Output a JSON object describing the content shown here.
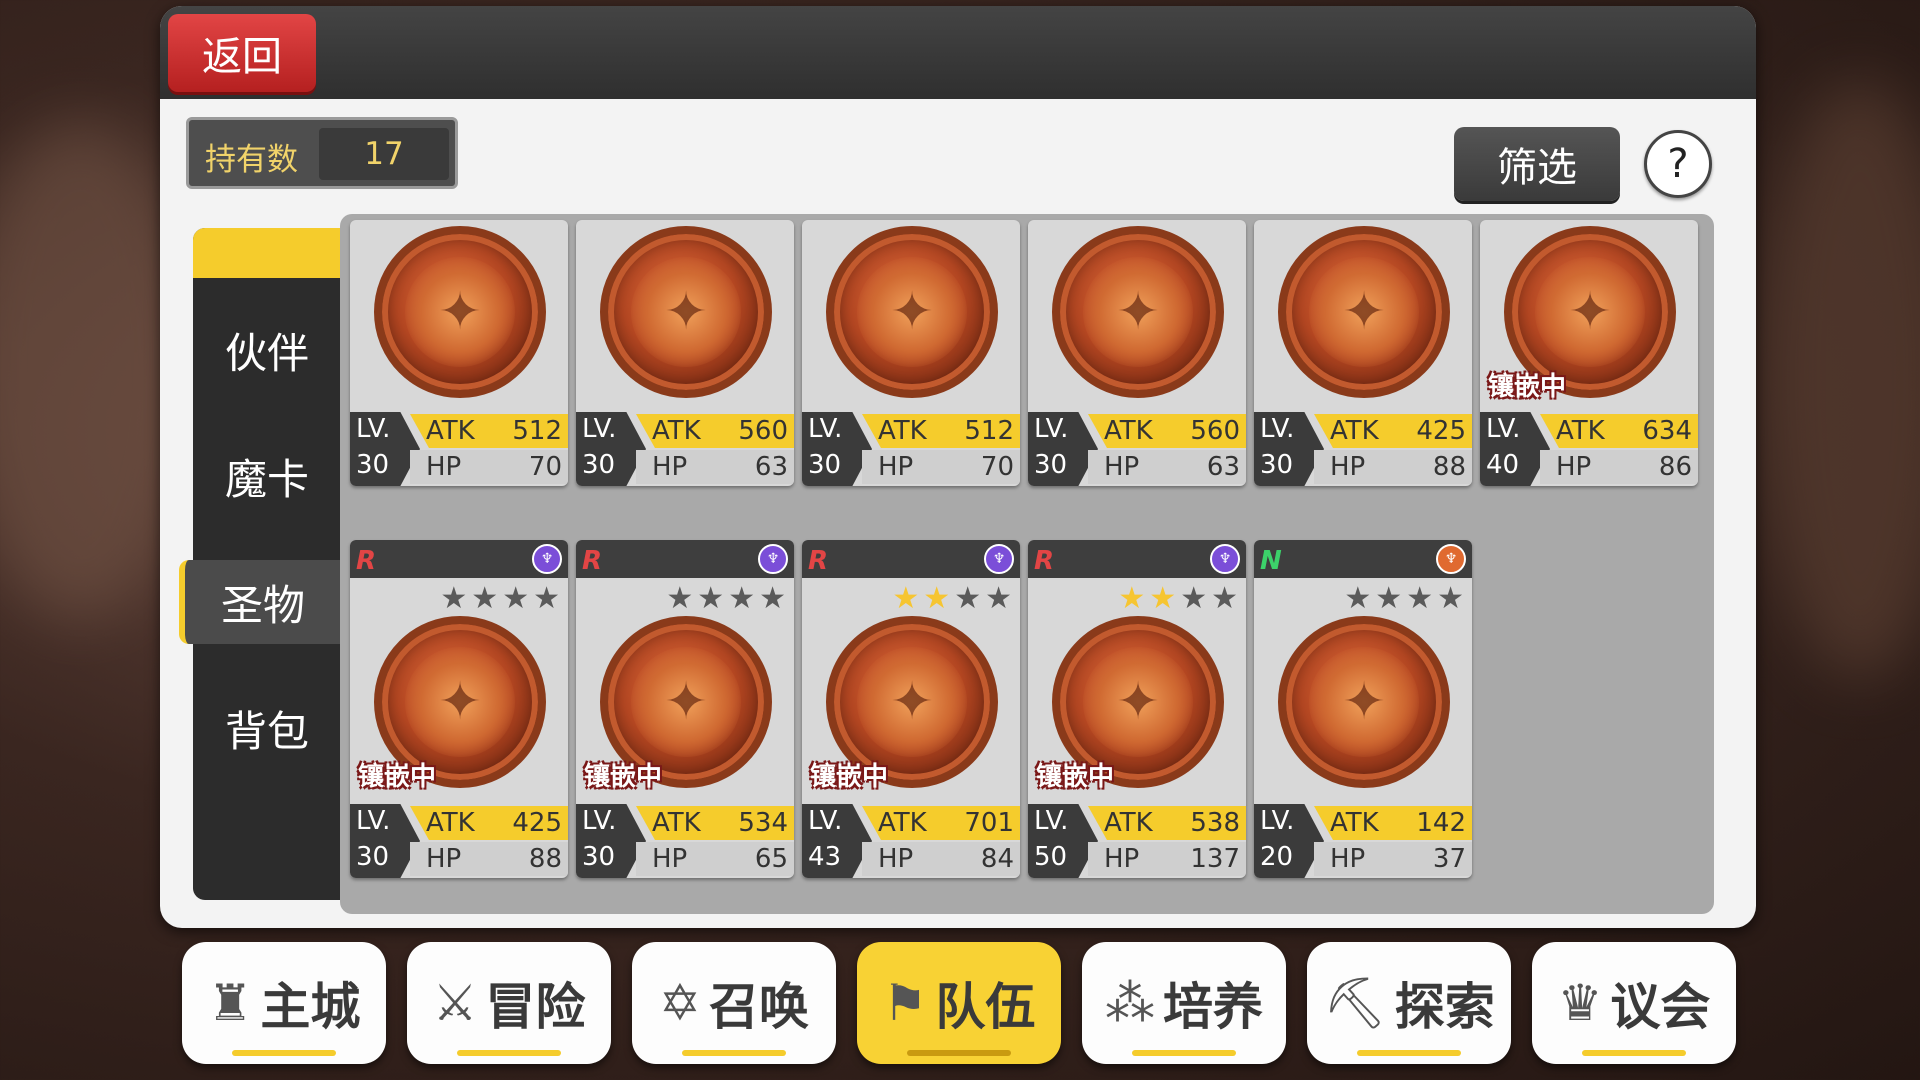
{
  "header": {
    "back_label": "返回"
  },
  "holdings": {
    "label": "持有数",
    "value": "17"
  },
  "toolbar": {
    "filter_label": "筛选",
    "help_label": "?"
  },
  "side_tabs": [
    {
      "label": "伙伴",
      "active": false
    },
    {
      "label": "魔卡",
      "active": false
    },
    {
      "label": "圣物",
      "active": true
    },
    {
      "label": "背包",
      "active": false
    }
  ],
  "relics": [
    {
      "lv_label": "LV.",
      "level": "30",
      "atk_label": "ATK",
      "atk": "512",
      "hp_label": "HP",
      "hp": "70",
      "inlay": ""
    },
    {
      "lv_label": "LV.",
      "level": "30",
      "atk_label": "ATK",
      "atk": "560",
      "hp_label": "HP",
      "hp": "63",
      "inlay": ""
    },
    {
      "lv_label": "LV.",
      "level": "30",
      "atk_label": "ATK",
      "atk": "512",
      "hp_label": "HP",
      "hp": "70",
      "inlay": ""
    },
    {
      "lv_label": "LV.",
      "level": "30",
      "atk_label": "ATK",
      "atk": "560",
      "hp_label": "HP",
      "hp": "63",
      "inlay": ""
    },
    {
      "lv_label": "LV.",
      "level": "30",
      "atk_label": "ATK",
      "atk": "425",
      "hp_label": "HP",
      "hp": "88",
      "inlay": ""
    },
    {
      "lv_label": "LV.",
      "level": "40",
      "atk_label": "ATK",
      "atk": "634",
      "hp_label": "HP",
      "hp": "86",
      "inlay": "镶嵌中"
    },
    {
      "lv_label": "LV.",
      "level": "30",
      "atk_label": "ATK",
      "atk": "425",
      "hp_label": "HP",
      "hp": "88",
      "inlay": "镶嵌中",
      "stars_on": 0,
      "rarity": "R",
      "element": "purple"
    },
    {
      "lv_label": "LV.",
      "level": "30",
      "atk_label": "ATK",
      "atk": "534",
      "hp_label": "HP",
      "hp": "65",
      "inlay": "镶嵌中",
      "stars_on": 0,
      "rarity": "R",
      "element": "purple"
    },
    {
      "lv_label": "LV.",
      "level": "43",
      "atk_label": "ATK",
      "atk": "701",
      "hp_label": "HP",
      "hp": "84",
      "inlay": "镶嵌中",
      "stars_on": 2,
      "rarity": "R",
      "element": "purple"
    },
    {
      "lv_label": "LV.",
      "level": "50",
      "atk_label": "ATK",
      "atk": "538",
      "hp_label": "HP",
      "hp": "137",
      "inlay": "镶嵌中",
      "stars_on": 2,
      "rarity": "R",
      "element": "purple"
    },
    {
      "lv_label": "LV.",
      "level": "20",
      "atk_label": "ATK",
      "atk": "142",
      "hp_label": "HP",
      "hp": "37",
      "inlay": "",
      "stars_on": 0,
      "rarity": "N",
      "element": "orange"
    }
  ],
  "bottom_nav": [
    {
      "label": "主城",
      "icon": "castle-icon",
      "glyph": "♜",
      "active": false
    },
    {
      "label": "冒险",
      "icon": "crossed-swords-icon",
      "glyph": "⚔",
      "active": false
    },
    {
      "label": "召唤",
      "icon": "hexagram-icon",
      "glyph": "✡",
      "active": false
    },
    {
      "label": "队伍",
      "icon": "team-flag-icon",
      "glyph": "⚑",
      "active": true
    },
    {
      "label": "培养",
      "icon": "triple-circle-icon",
      "glyph": "⁂",
      "active": false
    },
    {
      "label": "探索",
      "icon": "explore-icon",
      "glyph": "⛏",
      "active": false
    },
    {
      "label": "议会",
      "icon": "council-icon",
      "glyph": "♛",
      "active": false
    }
  ],
  "colors": {
    "accent": "#f5cc2c",
    "back_button": "#d63131",
    "rarity_r": "#e24545",
    "rarity_n": "#3cd26a"
  }
}
